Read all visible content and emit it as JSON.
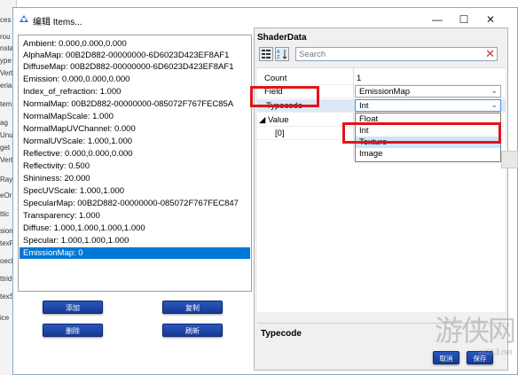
{
  "background_strip": [
    "ces",
    "rou",
    "nsta",
    "ype",
    "Vert",
    "eria",
    "tem",
    "ag",
    "Unu",
    "get",
    "Vert",
    "Ray",
    "eOr",
    "ttic",
    "sion",
    "texF",
    "oecl",
    "ttrid",
    "texS",
    "ice"
  ],
  "dialog": {
    "title": "编辑 Items...",
    "minimize": "—",
    "maximize": "☐",
    "close": "✕"
  },
  "items": [
    "Ambient:  0.000,0.000,0.000",
    "AlphaMap:  00B2D882-00000000-6D6023D423EF8AF1",
    "DiffuseMap:  00B2D882-00000000-6D6023D423EF8AF1",
    "Emission:  0.000,0.000,0.000",
    "Index_of_refraction:  1.000",
    "NormalMap:  00B2D882-00000000-085072F767FEC85A",
    "NormalMapScale:  1.000",
    "NormalMapUVChannel:  0.000",
    "NormalUVScale:  1.000,1.000",
    "Reflective:  0.000,0.000,0.000",
    "Reflectivity:  0.500",
    "Shininess:  20.000",
    "SpecUVScale:  1.000,1.000",
    "SpecularMap:  00B2D882-00000000-085072F767FEC847",
    "Transparency:  1.000",
    "Diffuse:  1.000,1.000,1.000,1.000",
    "Specular:  1.000,1.000,1.000",
    "EmissionMap:  0"
  ],
  "buttons": {
    "add": "添加",
    "copy": "复制",
    "remove": "删除",
    "refresh": "刷新",
    "cancel": "取消",
    "save": "保存"
  },
  "property_grid": {
    "header": "ShaderData",
    "search_placeholder": "Search",
    "rows": {
      "count_key": "Count",
      "count_val": "1",
      "field_key": "Field",
      "field_val": "EmissionMap",
      "typecode_key": "Typecode",
      "typecode_val": "Int",
      "value_key": "Value",
      "index_key": "[0]"
    },
    "dropdown_options": [
      "Float",
      "Int",
      "Texture",
      "Image"
    ],
    "description_title": "Typecode"
  },
  "watermark": "游侠网",
  "watermark_sub": "ali213.net",
  "colors": {
    "highlight": "#e0141a",
    "selection": "#0078d7",
    "button": "#2a56c0"
  }
}
